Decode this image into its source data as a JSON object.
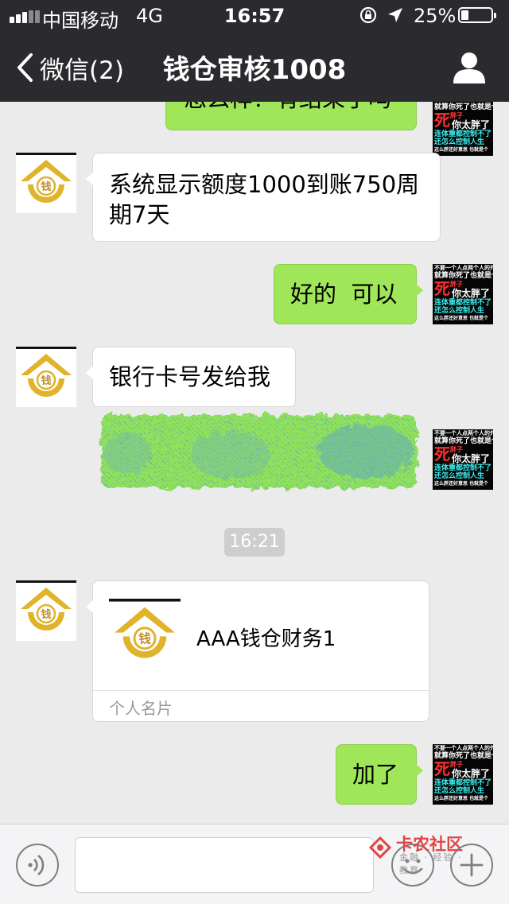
{
  "status_bar": {
    "carrier": "中国移动",
    "network": "4G",
    "time": "16:57",
    "battery_percent": "25%",
    "battery_level": 0.25
  },
  "nav": {
    "back_label": "微信(2)",
    "title": "钱仓审核1008"
  },
  "messages": {
    "partial_top": "怎么样？有结果了吗",
    "m1": "系统显示额度1000到账750周期7天",
    "m2": "好的  可以",
    "m3": "银行卡号发给我",
    "timestamp": "16:21",
    "m5": "加了"
  },
  "contact_card": {
    "name": "AAA钱仓财务1",
    "type_label": "个人名片"
  },
  "logo": {
    "char": "钱",
    "color": "#e0b32a"
  },
  "meme_avatar": {
    "line1": "不要一个人点两个人的外卖",
    "line2": "就算你死了也就是个",
    "big": "死",
    "small": "胖子",
    "line3": "你太胖了",
    "line4": "连体重都控制不了",
    "line5": "还怎么控制人生",
    "line6": "这么胖还好意思",
    "line7": "也就是个"
  },
  "watermark": {
    "text": "卡农社区",
    "sub": "金融 · 经验 · 教育"
  },
  "colors": {
    "nav_bg": "#2b2b2f",
    "chat_bg": "#ebebeb",
    "outgoing_bubble": "#9fe658",
    "incoming_bubble": "#ffffff"
  }
}
